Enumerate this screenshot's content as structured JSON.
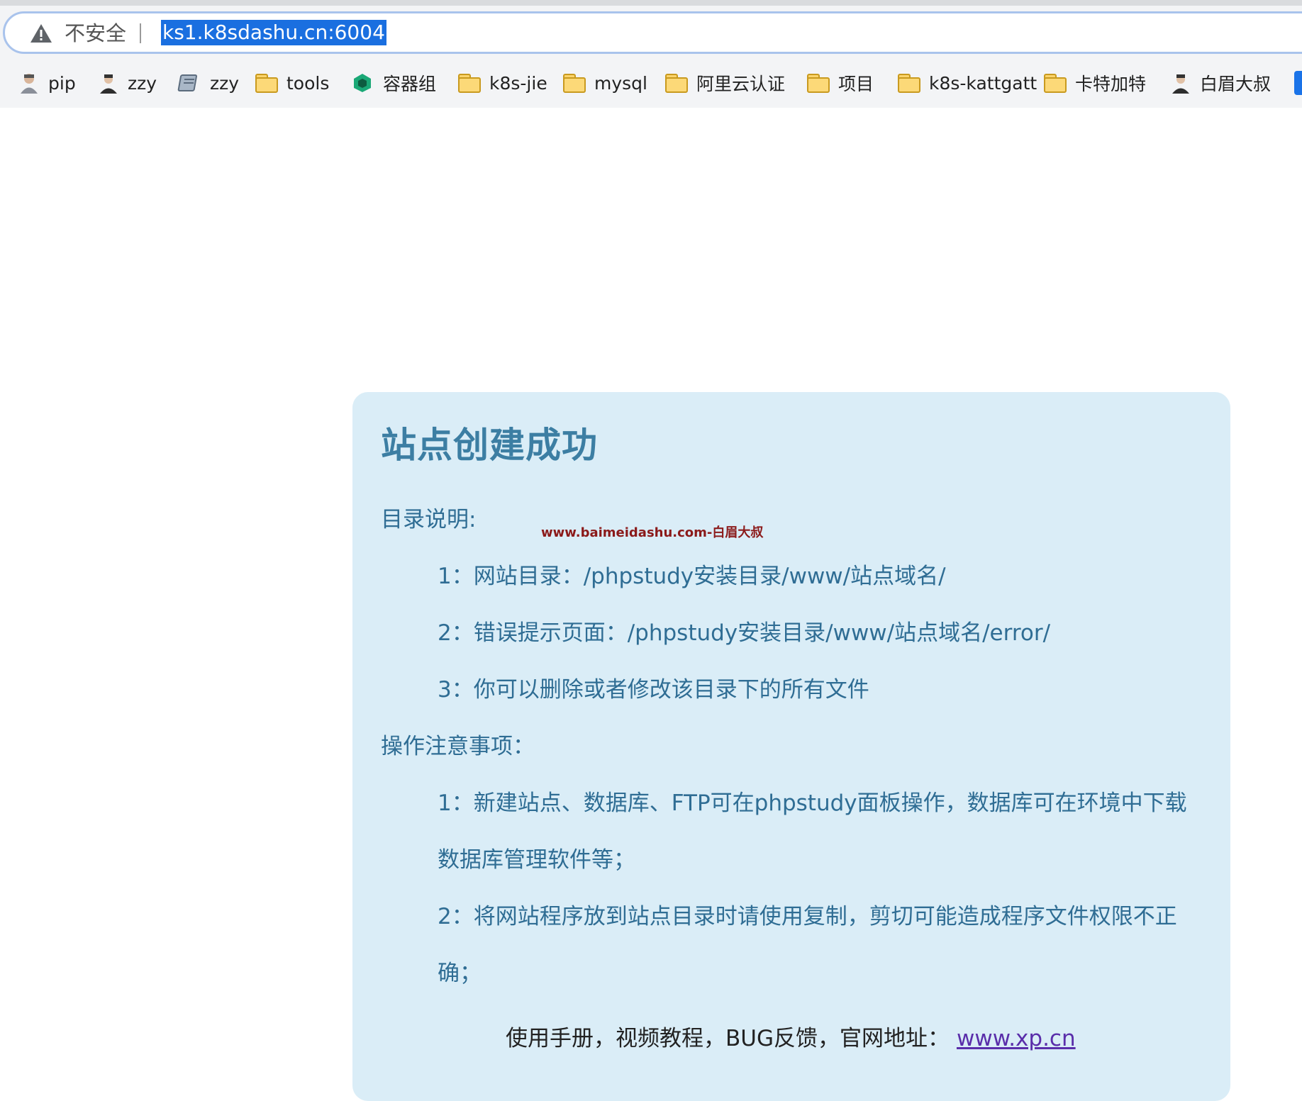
{
  "browser": {
    "security_label": "不安全",
    "url": "ks1.k8sdashu.cn:6004",
    "bookmarks": [
      {
        "label": "pip",
        "icon": "avatar-icon"
      },
      {
        "label": "zzy",
        "icon": "avatar-icon"
      },
      {
        "label": "zzy",
        "icon": "notebook-icon"
      },
      {
        "label": "tools",
        "icon": "folder-icon"
      },
      {
        "label": "容器组",
        "icon": "cube-logo-icon"
      },
      {
        "label": "k8s-jie",
        "icon": "folder-icon"
      },
      {
        "label": "mysql",
        "icon": "folder-icon"
      },
      {
        "label": "阿里云认证",
        "icon": "folder-icon"
      },
      {
        "label": "项目",
        "icon": "folder-icon"
      },
      {
        "label": "k8s-kattgatt",
        "icon": "folder-icon"
      },
      {
        "label": "卡特加特",
        "icon": "folder-icon"
      },
      {
        "label": "白眉大叔",
        "icon": "avatar-icon"
      }
    ]
  },
  "page": {
    "title": "站点创建成功",
    "watermark": "www.baimeidashu.com-白眉大叔",
    "dir_heading": "目录说明:",
    "dir_items": [
      "1：网站目录：/phpstudy安装目录/www/站点域名/",
      "2：错误提示页面：/phpstudy安装目录/www/站点域名/error/",
      "3：你可以删除或者修改该目录下的所有文件"
    ],
    "ops_heading": "操作注意事项：",
    "ops_items": [
      "1：新建站点、数据库、FTP可在phpstudy面板操作，数据库可在环境中下载",
      "数据库管理软件等；",
      "2：将网站程序放到站点目录时请使用复制，剪切可能造成程序文件权限不正",
      "确；"
    ],
    "footer_text": "使用手册，视频教程，BUG反馈，官网地址：",
    "footer_link": "www.xp.cn"
  }
}
